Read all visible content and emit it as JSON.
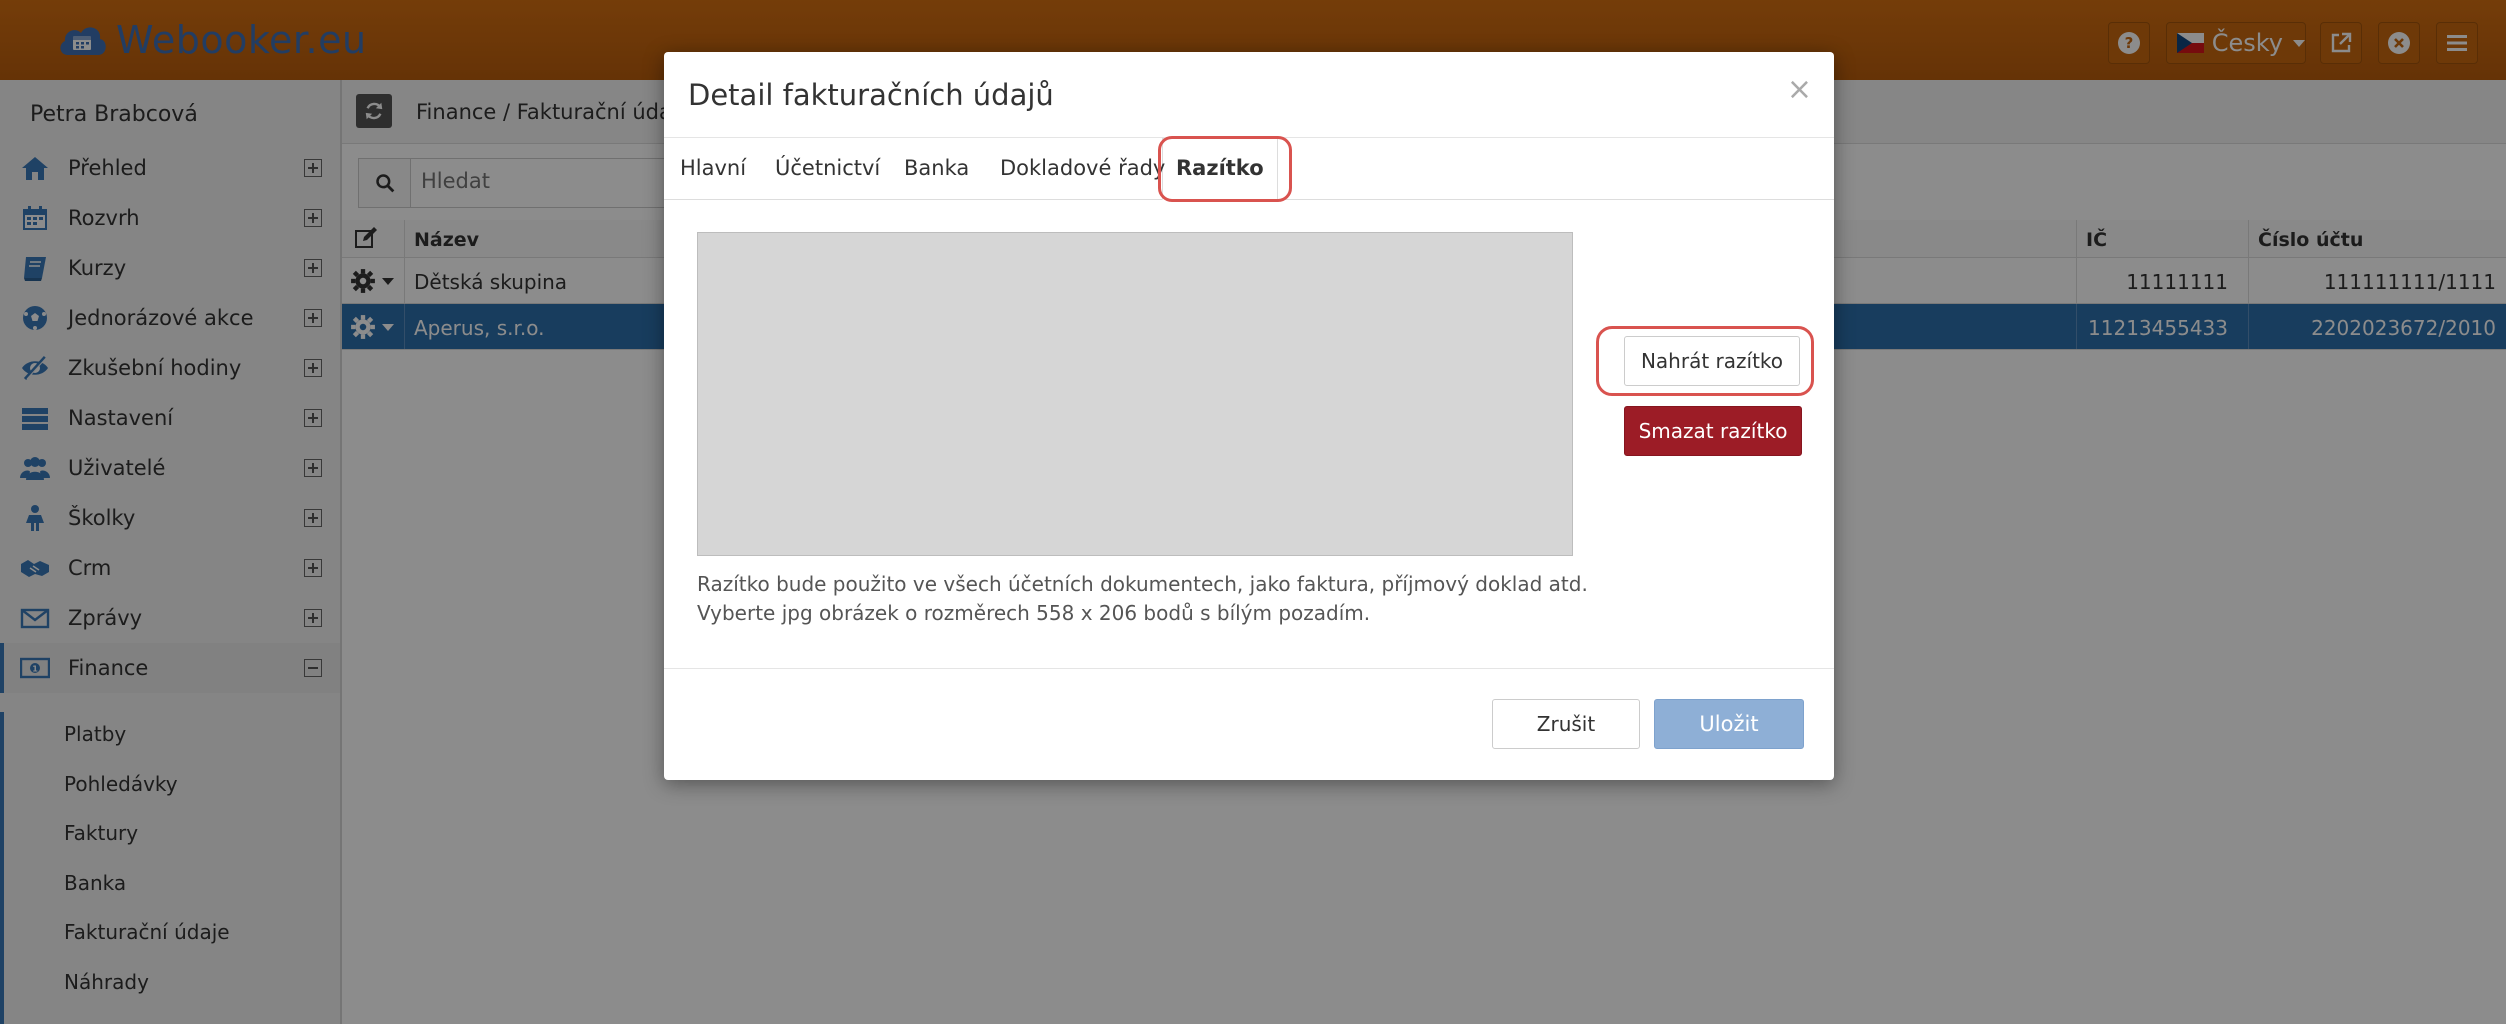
{
  "app": {
    "logo_text": "Webooker.eu"
  },
  "topbar": {
    "language_label": "Česky",
    "icons": [
      "help-icon",
      "external-link-icon",
      "close-circle-icon",
      "menu-icon"
    ]
  },
  "sidebar": {
    "user_name": "Petra Brabcová",
    "items": [
      {
        "label": "Přehled",
        "icon": "home-icon"
      },
      {
        "label": "Rozvrh",
        "icon": "calendar-icon"
      },
      {
        "label": "Kurzy",
        "icon": "book-icon"
      },
      {
        "label": "Jednorázové akce",
        "icon": "soccer-ball-icon"
      },
      {
        "label": "Zkušební hodiny",
        "icon": "eye-slash-icon"
      },
      {
        "label": "Nastavení",
        "icon": "server-icon"
      },
      {
        "label": "Uživatelé",
        "icon": "users-icon"
      },
      {
        "label": "Školky",
        "icon": "child-icon"
      },
      {
        "label": "Crm",
        "icon": "handshake-icon"
      },
      {
        "label": "Zprávy",
        "icon": "envelope-icon"
      },
      {
        "label": "Finance",
        "icon": "money-icon"
      }
    ],
    "finance_subitems": [
      "Platby",
      "Pohledávky",
      "Faktury",
      "Banka",
      "Fakturační údaje",
      "Náhrady"
    ]
  },
  "main": {
    "breadcrumb": "Finance / Fakturační údaje",
    "search_placeholder": "Hledat",
    "columns": {
      "name": "Název",
      "ic": "IČ",
      "account": "Číslo účtu"
    },
    "rows": [
      {
        "name": "Dětská skupina",
        "ic": "11111111",
        "account": "111111111/1111",
        "selected": false
      },
      {
        "name": "Aperus, s.r.o.",
        "ic": "11213455433",
        "account": "2202023672/2010",
        "selected": true
      }
    ]
  },
  "modal": {
    "title": "Detail fakturačních údajů",
    "close_symbol": "×",
    "tabs": [
      "Hlavní",
      "Účetnictví",
      "Banka",
      "Dokladové řady",
      "Razítko"
    ],
    "active_tab": "Razítko",
    "upload_label": "Nahrát razítko",
    "delete_label": "Smazat razítko",
    "help_line1": "Razítko bude použito ve všech účetních dokumentech, jako faktura, příjmový doklad atd.",
    "help_line2": "Vyberte jpg obrázek o rozměrech 558 x 206 bodů s bílým pozadím.",
    "cancel_label": "Zrušit",
    "save_label": "Uložit"
  },
  "colors": {
    "topbar": "#c8690f",
    "logo": "#3f6fb5",
    "selected_row": "#2d6fab",
    "delete_button": "#9c1c26",
    "save_button": "#8eafd6",
    "highlight": "#d9534f"
  }
}
